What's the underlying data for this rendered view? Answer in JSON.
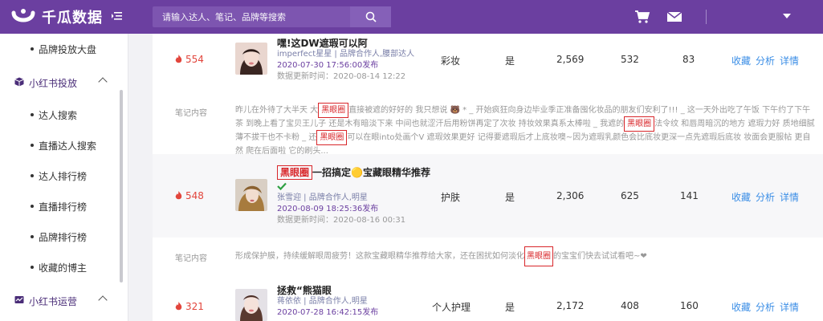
{
  "header": {
    "logo_text": "千瓜数据",
    "search_placeholder": "请输入达人、笔记、品牌等搜索",
    "icons": [
      "logo-icon",
      "menu-icon",
      "search-icon",
      "cart-icon",
      "mail-icon",
      "caret-down-icon"
    ],
    "brand_color": "#6b3fa0"
  },
  "sidebar": {
    "items": [
      {
        "type": "item",
        "label": "品牌投放大盘"
      },
      {
        "type": "group",
        "label": "小红书投放",
        "icon": "cube-icon"
      },
      {
        "type": "item",
        "label": "达人搜索"
      },
      {
        "type": "item",
        "label": "直播达人搜索"
      },
      {
        "type": "item",
        "label": "达人排行榜"
      },
      {
        "type": "item",
        "label": "直播排行榜"
      },
      {
        "type": "item",
        "label": "品牌排行榜"
      },
      {
        "type": "item",
        "label": "收藏的博主"
      },
      {
        "type": "group",
        "label": "小红书运营",
        "icon": "chart-icon"
      }
    ]
  },
  "rows": [
    {
      "rank": "554",
      "title": "嘿!这DW遮瑕可以阿",
      "author": "imperfect星星 | 品牌合作人,腰部达人",
      "published": "2020-07-30 17:56:00发布",
      "updated": "数据更新时间：2020-08-14 12:22",
      "category": "彩妆",
      "flag": "是",
      "v1": "2,569",
      "v2": "532",
      "v3": "83",
      "actions": [
        "收藏",
        "分析",
        "详情"
      ],
      "note_label": "笔记内容",
      "note_parts": [
        {
          "t": "昨儿在外待了大半天 大",
          "h": false
        },
        {
          "t": "黑眼圈",
          "h": true
        },
        {
          "t": "直接被遮的好好的 我只想说 🐻 * _ 开始疯狂向身边毕业季正准备囤化妆品的朋友们安利了!!! _ 这一天外出吃了午饭 下午约了下午茶 到晚上看了宝贝王儿子 还是木有暗淡下来 中间也就涩汗后用粉饼再定了次妆 持妆效果真系太棒啦 _ 我遮的",
          "h": false
        },
        {
          "t": "黑眼圈",
          "h": true
        },
        {
          "t": "法令纹 和唇周暗沉的地方 遮瑕力好 质地细腻薄不拔干也不卡粉 _ 还",
          "h": false
        },
        {
          "t": "黑眼圈",
          "h": true
        },
        {
          "t": "可以在眼into处画个V 遮瑕效果更好 记得要遮瑕后才上底妆噢~因为遮瑕乳颜色会比底妆更深一点先遮瑕后底妆 妆面会更服帖 更自然 爬在后面啦 它的刷头...",
          "h": false
        }
      ]
    },
    {
      "rank": "548",
      "title_hl": "黑眼圈",
      "title": "一招搞定🟡宝藏眼精华推荐",
      "author": "张雪迎 | 品牌合作人,明星",
      "published": "2020-08-09 18:25:36发布",
      "updated": "数据更新时间：2020-08-16 00:31",
      "category": "护肤",
      "flag": "是",
      "v1": "2,306",
      "v2": "625",
      "v3": "141",
      "actions": [
        "收藏",
        "分析",
        "详情"
      ],
      "note_label": "笔记内容",
      "note_parts": [
        {
          "t": "形成保护膜，持续缓解眼周疲劳！这款宝藏眼精华推荐给大家，还在困扰如何淡化",
          "h": false
        },
        {
          "t": "黑眼圈",
          "h": true
        },
        {
          "t": "的宝宝们快去试试看吧~❤",
          "h": false
        }
      ]
    },
    {
      "rank": "321",
      "title": "拯救“熊猫眼",
      "author": "蒋依依 | 品牌合作人,明星",
      "published": "2020-07-28 16:42:15发布",
      "category": "个人护理",
      "flag": "是",
      "v1": "2,172",
      "v2": "408",
      "v3": "160",
      "actions": [
        "收藏",
        "分析",
        "详情"
      ]
    }
  ]
}
